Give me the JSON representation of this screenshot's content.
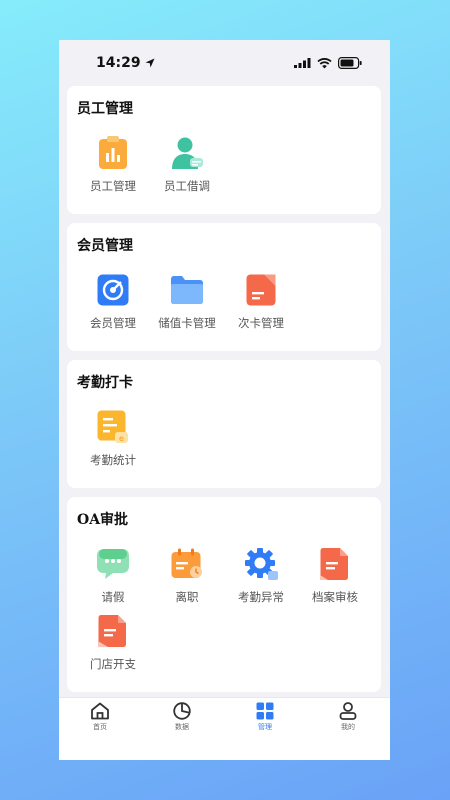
{
  "status": {
    "time": "14:29"
  },
  "sections": {
    "staff": {
      "title": "员工管理",
      "items": [
        "员工管理",
        "员工借调"
      ]
    },
    "member": {
      "title": "会员管理",
      "items": [
        "会员管理",
        "储值卡管理",
        "次卡管理"
      ]
    },
    "attendance": {
      "title": "考勤打卡",
      "items": [
        "考勤统计"
      ]
    },
    "oa": {
      "title": "OA审批",
      "items": [
        "请假",
        "离职",
        "考勤异常",
        "档案审核",
        "门店开支"
      ]
    }
  },
  "tabs": [
    "首页",
    "数据",
    "管理",
    "我的"
  ],
  "colors": {
    "accent": "#2f7cf6",
    "background": "#f2f2f6"
  }
}
